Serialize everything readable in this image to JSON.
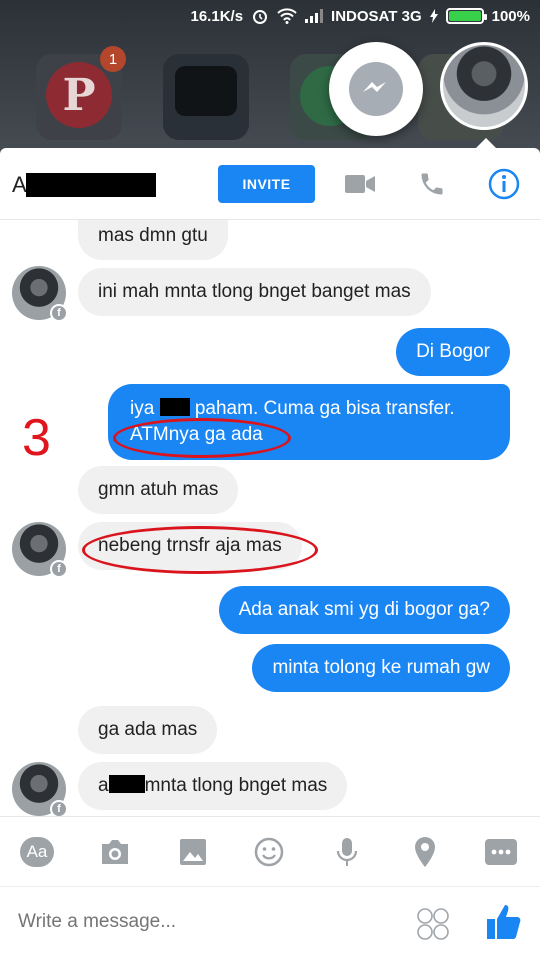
{
  "status": {
    "speed": "16.1K/s",
    "carrier": "INDOSAT 3G",
    "battery": "100%"
  },
  "home": {
    "pinterest_badge": "1",
    "pinterest_letter": "P"
  },
  "header": {
    "name_initial": "A",
    "invite": "INVITE"
  },
  "annotation": {
    "number": "3"
  },
  "messages": [
    {
      "side": "in",
      "text": "mas dmn gtu"
    },
    {
      "side": "in",
      "text": "ini mah mnta tlong bnget banget mas"
    },
    {
      "side": "out",
      "text": "Di Bogor"
    },
    {
      "side": "out",
      "line1_pre": "iya ",
      "line1_post": " paham. Cuma ga bisa transfer.",
      "line2": "ATMnya ga ada"
    },
    {
      "side": "in",
      "text": "gmn atuh mas"
    },
    {
      "side": "in",
      "text": "nebeng trnsfr aja mas"
    },
    {
      "side": "out",
      "text": "Ada anak smi yg di bogor ga?"
    },
    {
      "side": "out",
      "text": "minta tolong ke rumah gw"
    },
    {
      "side": "in",
      "text": "ga ada mas"
    },
    {
      "side": "in",
      "pre": "a",
      "post": "mnta tlong bnget mas"
    }
  ],
  "toolbar": {
    "aa": "Aa"
  },
  "composer": {
    "placeholder": "Write a message..."
  },
  "colors": {
    "blue": "#1a86f4",
    "bubble_in": "#f0f0f0",
    "annotation_red": "#d9141d"
  }
}
